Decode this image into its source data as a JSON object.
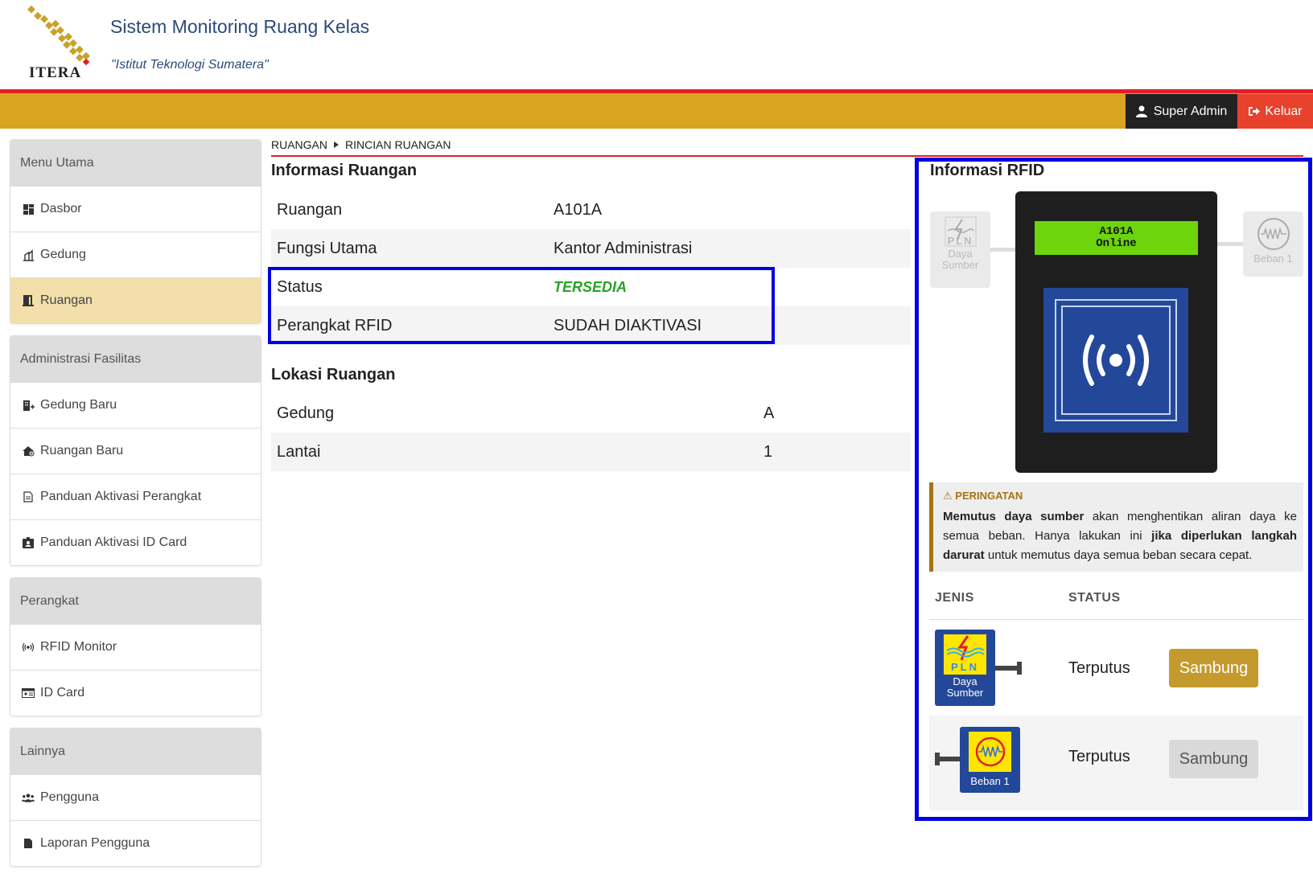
{
  "header": {
    "logo_text": "ITERA",
    "title": "Sistem Monitoring Ruang Kelas",
    "subtitle": "\"Istitut Teknologi Sumatera\"",
    "user_label": "Super Admin",
    "logout_label": "Keluar"
  },
  "sidebar": {
    "groups": [
      {
        "title": "Menu Utama",
        "items": [
          {
            "label": "Dasbor",
            "icon": "dashboard-icon"
          },
          {
            "label": "Gedung",
            "icon": "building-icon"
          },
          {
            "label": "Ruangan",
            "icon": "door-icon",
            "active": true
          }
        ]
      },
      {
        "title": "Administrasi Fasilitas",
        "items": [
          {
            "label": "Gedung Baru",
            "icon": "building-add-icon"
          },
          {
            "label": "Ruangan Baru",
            "icon": "room-add-icon"
          },
          {
            "label": "Panduan Aktivasi Perangkat",
            "icon": "document-icon"
          },
          {
            "label": "Panduan Aktivasi ID Card",
            "icon": "id-badge-icon"
          }
        ]
      },
      {
        "title": "Perangkat",
        "items": [
          {
            "label": "RFID Monitor",
            "icon": "broadcast-icon"
          },
          {
            "label": "ID Card",
            "icon": "id-card-icon"
          }
        ]
      },
      {
        "title": "Lainnya",
        "items": [
          {
            "label": "Pengguna",
            "icon": "users-icon"
          },
          {
            "label": "Laporan Pengguna",
            "icon": "report-icon"
          }
        ]
      }
    ]
  },
  "breadcrumb": {
    "root": "RUANGAN",
    "current": "RINCIAN RUANGAN"
  },
  "room_info": {
    "title": "Informasi Ruangan",
    "rows": [
      {
        "label": "Ruangan",
        "value": "A101A"
      },
      {
        "label": "Fungsi Utama",
        "value": "Kantor Administrasi"
      },
      {
        "label": "Status",
        "value": "TERSEDIA"
      },
      {
        "label": "Perangkat RFID",
        "value": "SUDAH DIAKTIVASI"
      }
    ]
  },
  "location": {
    "title": "Lokasi Ruangan",
    "rows": [
      {
        "label": "Gedung",
        "value": "A"
      },
      {
        "label": "Lantai",
        "value": "1"
      }
    ]
  },
  "rfid": {
    "title": "Informasi RFID",
    "device_room": "A101A",
    "device_status": "Online",
    "ghost_source_label_1": "Daya",
    "ghost_source_label_2": "Sumber",
    "ghost_pln": "PLN",
    "ghost_load_label": "Beban 1",
    "warning": {
      "title": "PERINGATAN",
      "bold1": "Memutus daya sumber",
      "text1": " akan menghentikan aliran daya ke semua beban. Hanya lakukan ini ",
      "bold2": "jika diperlukan langkah darurat",
      "text2": " untuk memutus daya semua beban secara cepat."
    },
    "col_jenis": "JENIS",
    "col_status": "STATUS",
    "loads": [
      {
        "tile_pln": "PLN",
        "tile_label_1": "Daya",
        "tile_label_2": "Sumber",
        "status": "Terputus",
        "button": "Sambung",
        "button_enabled": true
      },
      {
        "tile_label_1": "Beban 1",
        "status": "Terputus",
        "button": "Sambung",
        "button_enabled": false
      }
    ]
  },
  "colors": {
    "accent_red": "#e41e26",
    "gold": "#d9a41f",
    "highlight": "#0000e0",
    "lcd_green": "#6ed40b",
    "device_blue": "#23489a"
  }
}
